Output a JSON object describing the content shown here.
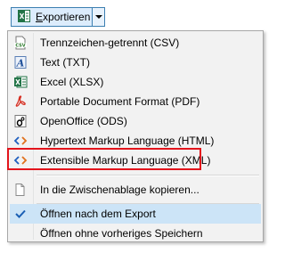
{
  "button": {
    "label_prefix": "",
    "label_underlined": "E",
    "label_rest": "xportieren",
    "icon": "excel-export-icon"
  },
  "menu": {
    "items": [
      {
        "label": "Trennzeichen-getrennt (CSV)",
        "icon": "csv-file-icon"
      },
      {
        "label": "Text (TXT)",
        "icon": "text-file-icon"
      },
      {
        "label": "Excel (XLSX)",
        "icon": "excel-file-icon"
      },
      {
        "label": "Portable Document Format (PDF)",
        "icon": "pdf-file-icon"
      },
      {
        "label": "OpenOffice (ODS)",
        "icon": "openoffice-file-icon"
      },
      {
        "label": "Hypertext Markup Language (HTML)",
        "icon": "html-file-icon"
      },
      {
        "label": "Extensible Markup Language (XML)",
        "icon": "xml-file-icon"
      }
    ],
    "clipboard": {
      "label": "In die Zwischenablage kopieren...",
      "icon": "clipboard-icon"
    },
    "options": [
      {
        "label": "Öffnen nach dem Export",
        "checked": true
      },
      {
        "label": "Öffnen ohne vorheriges Speichern",
        "checked": false
      }
    ]
  },
  "colors": {
    "accent": "#3c7fb1",
    "highlight_border": "#e3141c",
    "checked_bg": "#cce4f7"
  }
}
